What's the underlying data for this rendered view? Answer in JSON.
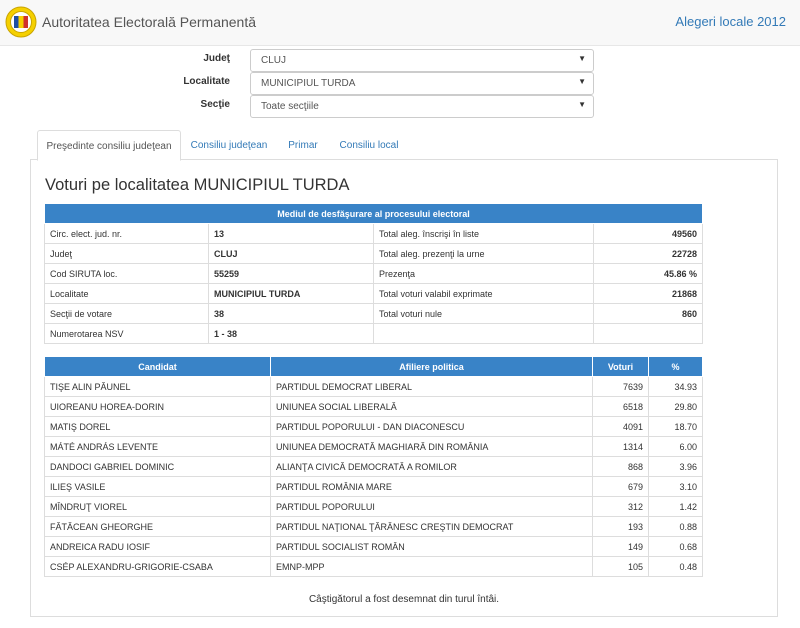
{
  "header": {
    "brand": "Autoritatea Electorală Permanentă",
    "right_link": "Alegeri locale 2012"
  },
  "filters": [
    {
      "label": "Judeţ",
      "value": "CLUJ"
    },
    {
      "label": "Localitate",
      "value": "MUNICIPIUL TURDA"
    },
    {
      "label": "Secţie",
      "value": "Toate secţiile"
    }
  ],
  "tabs": [
    {
      "label": "Preşedinte consiliu judeţean",
      "active": true
    },
    {
      "label": "Consiliu judeţean",
      "active": false
    },
    {
      "label": "Primar",
      "active": false
    },
    {
      "label": "Consiliu local",
      "active": false
    }
  ],
  "page_title": "Voturi pe localitatea MUNICIPIUL TURDA",
  "info_table": {
    "heading": "Mediul de desfăşurare al procesului electoral",
    "rows": [
      [
        "Circ. elect. jud. nr.",
        "13",
        "Total aleg. înscrişi în liste",
        "49560"
      ],
      [
        "Judeţ",
        "CLUJ",
        "Total aleg. prezenţi la urne",
        "22728"
      ],
      [
        "Cod SIRUTA loc.",
        "55259",
        "Prezenţa",
        "45.86 %"
      ],
      [
        "Localitate",
        "MUNICIPIUL TURDA",
        "Total voturi valabil exprimate",
        "21868"
      ],
      [
        "Secţii de votare",
        "38",
        "Total voturi nule",
        "860"
      ],
      [
        "Numerotarea NSV",
        "1 - 38",
        "",
        ""
      ]
    ]
  },
  "results_table": {
    "headers": [
      "Candidat",
      "Afiliere politica",
      "Voturi",
      "%"
    ],
    "rows": [
      [
        "TIŞE ALIN PĂUNEL",
        "PARTIDUL DEMOCRAT LIBERAL",
        "7639",
        "34.93"
      ],
      [
        "UIOREANU HOREA-DORIN",
        "UNIUNEA SOCIAL LIBERALĂ",
        "6518",
        "29.80"
      ],
      [
        "MATIŞ DOREL",
        "PARTIDUL POPORULUI - DAN DIACONESCU",
        "4091",
        "18.70"
      ],
      [
        "MÁTÉ ANDRÁS LEVENTE",
        "UNIUNEA DEMOCRATĂ MAGHIARĂ DIN ROMÂNIA",
        "1314",
        "6.00"
      ],
      [
        "DANDOCI GABRIEL DOMINIC",
        "ALIANŢA CIVICĂ DEMOCRATĂ A ROMILOR",
        "868",
        "3.96"
      ],
      [
        "ILIEŞ VASILE",
        "PARTIDUL ROMÂNIA MARE",
        "679",
        "3.10"
      ],
      [
        "MÎNDRUŢ VIOREL",
        "PARTIDUL POPORULUI",
        "312",
        "1.42"
      ],
      [
        "FĂTĂCEAN GHEORGHE",
        "PARTIDUL NAŢIONAL ŢĂRĂNESC CREŞTIN DEMOCRAT",
        "193",
        "0.88"
      ],
      [
        "ANDREICA RADU IOSIF",
        "PARTIDUL SOCIALIST ROMÂN",
        "149",
        "0.68"
      ],
      [
        "CSÉP ALEXANDRU-GRIGORIE-CSABA",
        "EMNP-MPP",
        "105",
        "0.48"
      ]
    ]
  },
  "footer_note": "Câştigătorul a fost desemnat din turul întâi.",
  "colors": {
    "accent": "#3983c7",
    "link": "#337ab7"
  }
}
